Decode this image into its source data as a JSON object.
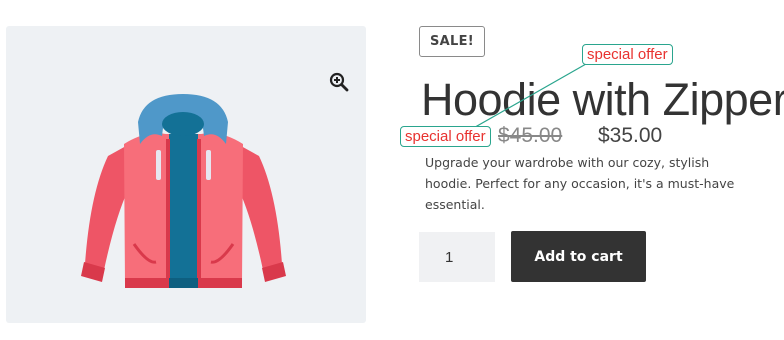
{
  "product": {
    "sale_badge": "SALE!",
    "title": "Hoodie with Zipper",
    "old_price": "$45.00",
    "new_price": "$35.00",
    "description": "Upgrade your wardrobe with our cozy, stylish hoodie. Perfect for any occasion, it's a must-have essential.",
    "image_alt": "Hoodie with Zipper",
    "zoom_icon": "magnifier-plus-icon"
  },
  "cart": {
    "quantity": "1",
    "add_to_cart_label": "Add to cart"
  },
  "annotations": [
    {
      "label": "special offer"
    },
    {
      "label": "special offer"
    }
  ],
  "colors": {
    "gallery_bg": "#eef1f4",
    "button_bg": "#333333",
    "annotation_text": "#e8322f",
    "annotation_border": "#2aa58e"
  }
}
